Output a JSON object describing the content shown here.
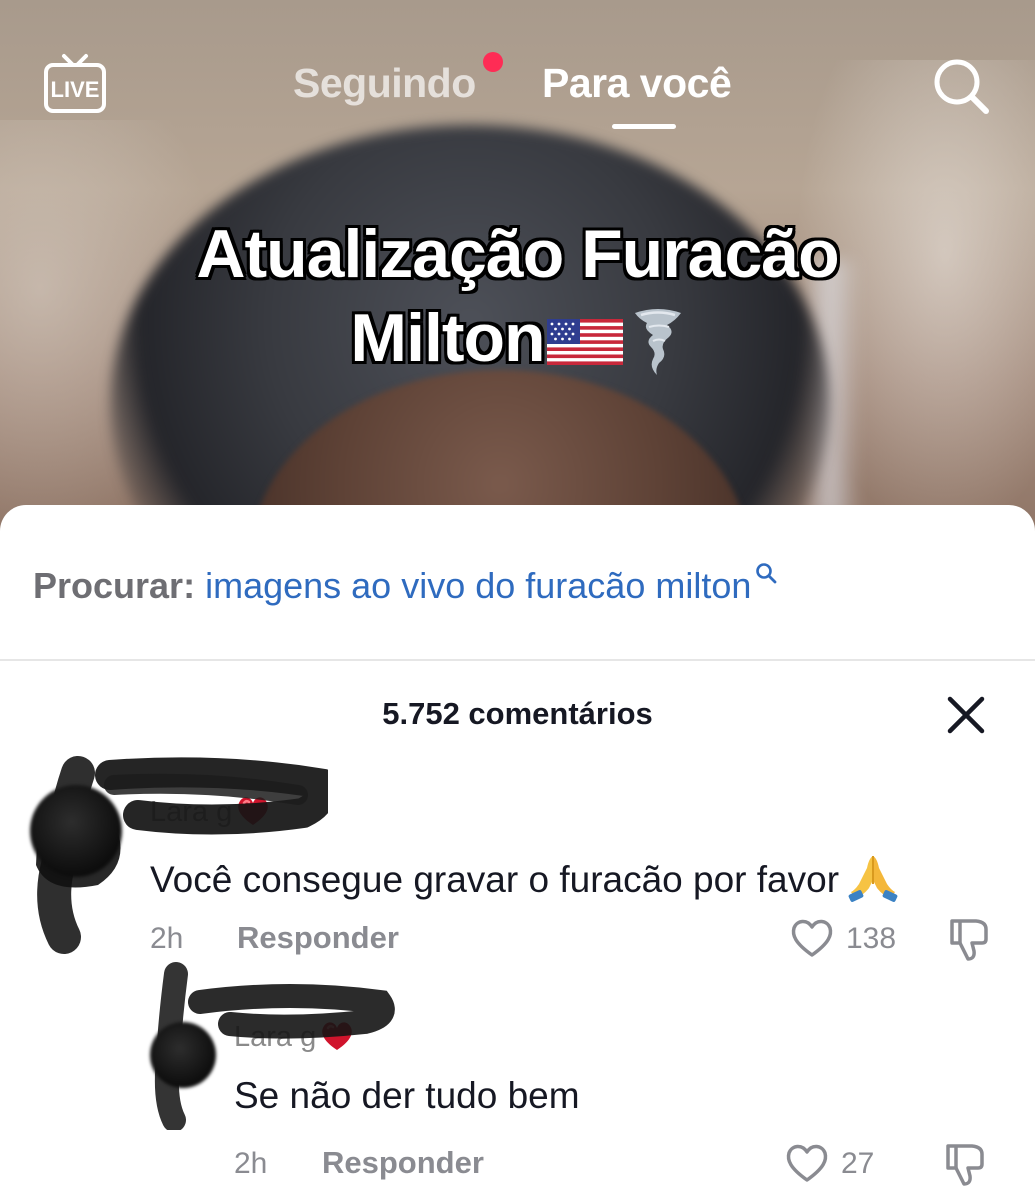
{
  "nav": {
    "live_label": "LIVE",
    "following_label": "Seguindo",
    "for_you_label": "Para você"
  },
  "video": {
    "caption_line1": "Atualização Furacão",
    "caption_line2": "Milton",
    "caption_emojis": [
      "us-flag",
      "tornado"
    ]
  },
  "search_suggestion": {
    "prefix": "Procurar:",
    "query": "imagens ao vivo do furacão milton"
  },
  "comments_header": {
    "count_label": "5.752 comentários"
  },
  "comments": [
    {
      "username": "Lara g",
      "username_emoji": "red-heart",
      "text": "Você consegue gravar o furacão por favor",
      "text_emoji": "folded-hands",
      "time": "2h",
      "reply_label": "Responder",
      "likes": "138"
    },
    {
      "username": "Lara g",
      "username_emoji": "red-heart",
      "text": "Se não der tudo bem",
      "time": "2h",
      "reply_label": "Responder",
      "likes": "27"
    }
  ],
  "colors": {
    "notification_dot": "#fe2c55",
    "search_query": "#2f6bbf",
    "secondary_text": "#8a8b91"
  }
}
